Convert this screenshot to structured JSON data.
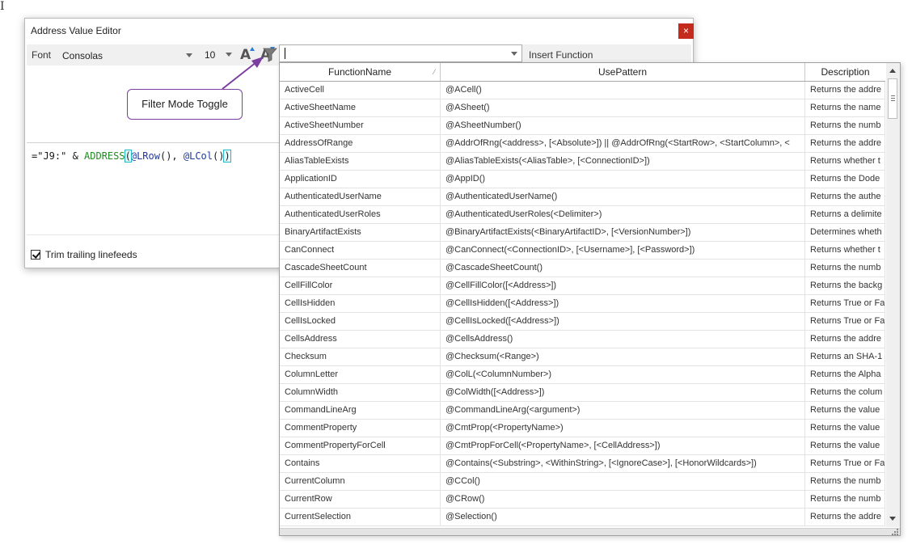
{
  "corner_glyph": "I",
  "dialog": {
    "title": "Address Value Editor",
    "close_label": "×",
    "font_label": "Font",
    "font_value": "Consolas",
    "font_size": "10",
    "grow_glyph": "A",
    "shrink_glyph": "A",
    "insert_function_label": "Insert Function",
    "trim_label": "Trim trailing linefeeds",
    "trim_checked": true
  },
  "editor": {
    "p1": "=\"J9:\" & ",
    "fn": "ADDRESS",
    "open": "(",
    "a1": "@LRow",
    "p2": "(), ",
    "a2": "@LCol",
    "p3": "()",
    "close": ")"
  },
  "callout": {
    "text": "Filter Mode Toggle",
    "border_color": "#7a3fa0"
  },
  "search": {
    "value": ""
  },
  "table": {
    "columns": [
      "FunctionName",
      "UsePattern",
      "Description"
    ],
    "sort_mark": "⁄",
    "rows": [
      [
        "ActiveCell",
        "@ACell()",
        "Returns the addre"
      ],
      [
        "ActiveSheetName",
        "@ASheet()",
        "Returns the name"
      ],
      [
        "ActiveSheetNumber",
        "@ASheetNumber()",
        "Returns the numb"
      ],
      [
        "AddressOfRange",
        "@AddrOfRng(<address>, [<Absolute>]) || @AddrOfRng(<StartRow>, <StartColumn>, <",
        "Returns the addre"
      ],
      [
        "AliasTableExists",
        "@AliasTableExists(<AliasTable>, [<ConnectionID>])",
        "Returns whether t"
      ],
      [
        "ApplicationID",
        "@AppID()",
        "Returns the Dode"
      ],
      [
        "AuthenticatedUserName",
        "@AuthenticatedUserName()",
        "Returns the authe"
      ],
      [
        "AuthenticatedUserRoles",
        "@AuthenticatedUserRoles(<Delimiter>)",
        "Returns a delimite"
      ],
      [
        "BinaryArtifactExists",
        "@BinaryArtifactExists(<BinaryArtifactID>, [<VersionNumber>])",
        "Determines wheth"
      ],
      [
        "CanConnect",
        "@CanConnect(<ConnectionID>, [<Username>], [<Password>])",
        "Returns whether t"
      ],
      [
        "CascadeSheetCount",
        "@CascadeSheetCount()",
        "Returns the numb"
      ],
      [
        "CellFillColor",
        "@CellFillColor([<Address>])",
        "Returns the backg"
      ],
      [
        "CellIsHidden",
        "@CellIsHidden([<Address>])",
        "Returns True or Fa"
      ],
      [
        "CellIsLocked",
        "@CellIsLocked([<Address>])",
        "Returns True or Fa"
      ],
      [
        "CellsAddress",
        "@CellsAddress()",
        "Returns the addre"
      ],
      [
        "Checksum",
        "@Checksum(<Range>)",
        "Returns an SHA-1"
      ],
      [
        "ColumnLetter",
        "@ColL(<ColumnNumber>)",
        "Returns the Alpha"
      ],
      [
        "ColumnWidth",
        "@ColWidth([<Address>])",
        "Returns the colum"
      ],
      [
        "CommandLineArg",
        "@CommandLineArg(<argument>)",
        "Returns the value"
      ],
      [
        "CommentProperty",
        "@CmtProp(<PropertyName>)",
        "Returns the value"
      ],
      [
        "CommentPropertyForCell",
        "@CmtPropForCell(<PropertyName>, [<CellAddress>])",
        "Returns the value"
      ],
      [
        "Contains",
        "@Contains(<Substring>, <WithinString>, [<IgnoreCase>], [<HonorWildcards>])",
        "Returns True or Fa"
      ],
      [
        "CurrentColumn",
        "@CCol()",
        "Returns the numb"
      ],
      [
        "CurrentRow",
        "@CRow()",
        "Returns the numb"
      ],
      [
        "CurrentSelection",
        "@Selection()",
        "Returns the addre"
      ]
    ]
  },
  "colors": {
    "close_red": "#c42b1c",
    "accent_blue": "#2a7fd3",
    "code_fn_green": "#228b22",
    "brace_highlight": "#22b8c8"
  }
}
